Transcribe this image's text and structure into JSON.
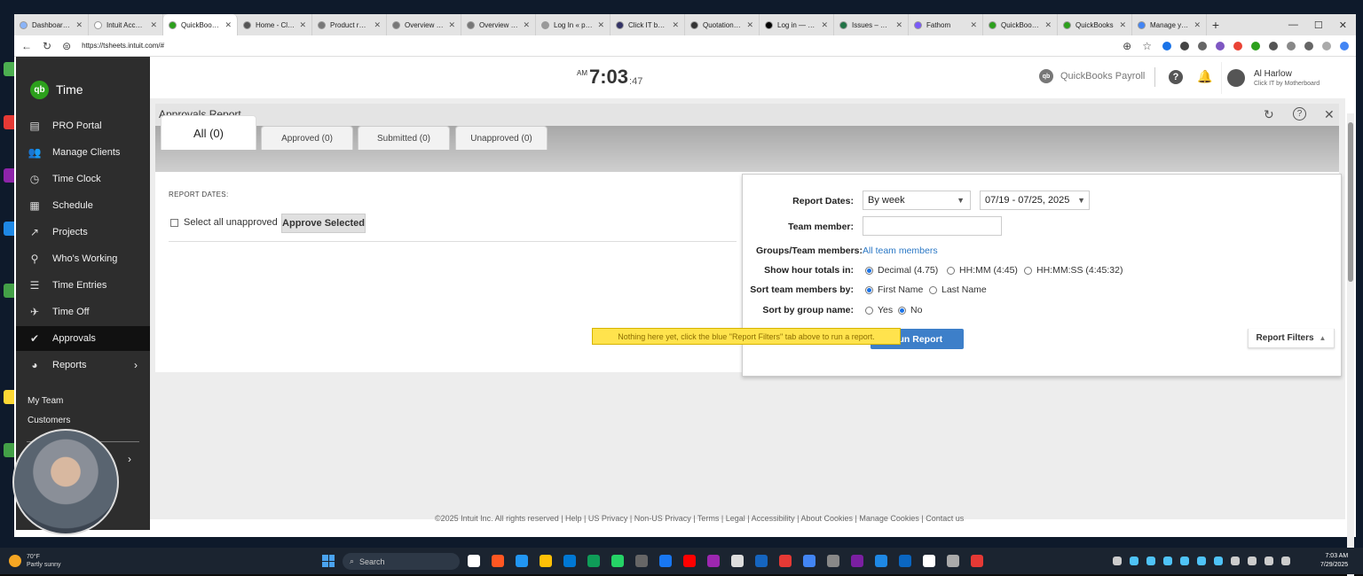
{
  "browser": {
    "tabs": [
      {
        "title": "Dashboard – C",
        "color": "#8ab4f8"
      },
      {
        "title": "Intuit Account",
        "color": "#ffffff"
      },
      {
        "title": "QuickBooks Ti",
        "color": "#2ca01c",
        "active": true
      },
      {
        "title": "Home - Click I",
        "color": "#555555"
      },
      {
        "title": "Product reque",
        "color": "#777777"
      },
      {
        "title": "Overview | Ad",
        "color": "#777777"
      },
      {
        "title": "Overview | Ad",
        "color": "#777777"
      },
      {
        "title": "Log In « putto",
        "color": "#999999"
      },
      {
        "title": "Click IT by Mo",
        "color": "#333366"
      },
      {
        "title": "Quotation – W",
        "color": "#333333"
      },
      {
        "title": "Log in — Kicks",
        "color": "#000000"
      },
      {
        "title": "Issues – Traini",
        "color": "#217346"
      },
      {
        "title": "Fathom",
        "color": "#7a5af8"
      },
      {
        "title": "QuickBooks Pa",
        "color": "#2ca01c"
      },
      {
        "title": "QuickBooks",
        "color": "#2ca01c"
      },
      {
        "title": "Manage your",
        "color": "#4285f4"
      }
    ],
    "url": "https://tsheets.intuit.com/#"
  },
  "sidebar": {
    "app_name": "Time",
    "logo_text": "qb",
    "items": [
      {
        "label": "PRO Portal",
        "icon": "portal-icon",
        "glyph": "▤"
      },
      {
        "label": "Manage Clients",
        "icon": "people-icon",
        "glyph": "👥"
      },
      {
        "label": "Time Clock",
        "icon": "clock-icon",
        "glyph": "◷"
      },
      {
        "label": "Schedule",
        "icon": "calendar-icon",
        "glyph": "▦"
      },
      {
        "label": "Projects",
        "icon": "trend-icon",
        "glyph": "↗"
      },
      {
        "label": "Who's Working",
        "icon": "location-pin-icon",
        "glyph": "⚲"
      },
      {
        "label": "Time Entries",
        "icon": "list-clock-icon",
        "glyph": "☰"
      },
      {
        "label": "Time Off",
        "icon": "airplane-icon",
        "glyph": "✈"
      },
      {
        "label": "Approvals",
        "icon": "double-check-icon",
        "glyph": "✔",
        "active": true
      },
      {
        "label": "Reports",
        "icon": "pie-chart-icon",
        "glyph": "◕",
        "has_chevron": true
      }
    ],
    "sub_links": [
      "My Team",
      "Customers"
    ]
  },
  "topbar": {
    "clock_ampm": "AM",
    "clock_hm": "7:03",
    "clock_sec": ":47",
    "payroll_label": "QuickBooks Payroll",
    "user_name": "Al Harlow",
    "user_company": "Click IT by Motherboard"
  },
  "report": {
    "title": "Approvals Report",
    "tabs": [
      {
        "label": "All (0)",
        "active": true
      },
      {
        "label": "Approved (0)"
      },
      {
        "label": "Submitted (0)"
      },
      {
        "label": "Unapproved (0)"
      }
    ],
    "report_dates_label": "REPORT DATES:",
    "select_all_label": "Select all unapproved",
    "approve_button": "Approve Selected",
    "empty_notice": "Nothing here yet, click the blue \"Report Filters\" tab above to run a report.",
    "filters_tab_label": "Report Filters"
  },
  "filters": {
    "report_dates_label": "Report Dates:",
    "period_value": "By week",
    "range_value": "07/19 - 07/25, 2025",
    "team_member_label": "Team member:",
    "team_member_value": "",
    "groups_label": "Groups/Team members:",
    "groups_link": "All team members",
    "hour_totals_label": "Show hour totals in:",
    "hour_options": [
      {
        "label": "Decimal (4.75)",
        "selected": true
      },
      {
        "label": "HH:MM (4:45)",
        "selected": false
      },
      {
        "label": "HH:MM:SS (4:45:32)",
        "selected": false
      }
    ],
    "sort_by_label": "Sort team members by:",
    "sort_options": [
      {
        "label": "First Name",
        "selected": true
      },
      {
        "label": "Last Name",
        "selected": false
      }
    ],
    "group_sort_label": "Sort by group name:",
    "group_sort_options": [
      {
        "label": "Yes",
        "selected": false
      },
      {
        "label": "No",
        "selected": true
      }
    ],
    "run_button": "Run Report"
  },
  "footer": {
    "text": "©2025 Intuit Inc. All rights reserved  |  Help  |  US Privacy  |  Non-US Privacy  |  Terms  |  Legal  |  Accessibility  |  About Cookies  |  Manage Cookies  |  Contact us"
  },
  "taskbar": {
    "weather_temp": "70°F",
    "weather_desc": "Partly sunny",
    "search_placeholder": "Search",
    "time": "7:03 AM",
    "date": "7/29/2025"
  }
}
